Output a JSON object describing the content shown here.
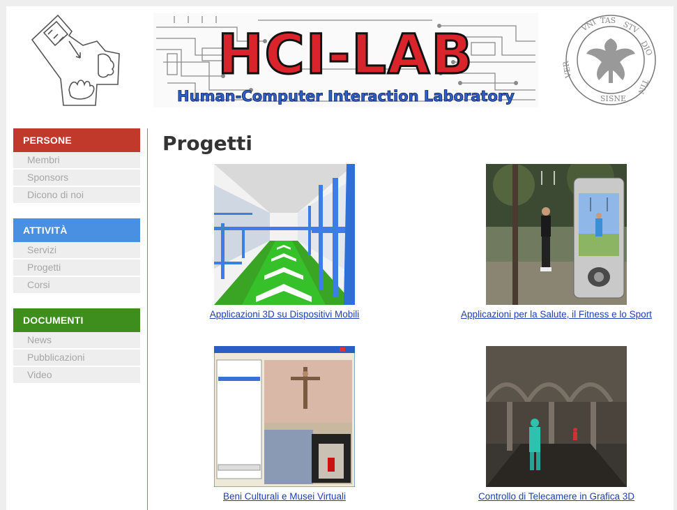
{
  "header": {
    "banner_title": "HCI-LAB",
    "banner_subtitle": "Human-Computer Interaction Laboratory"
  },
  "sidebar": {
    "sections": [
      {
        "title": "PERSONE",
        "color": "#c0392b",
        "items": [
          "Membri",
          "Sponsors",
          "Dicono di noi"
        ]
      },
      {
        "title": "ATTIVITÀ",
        "color": "#4a90e2",
        "items": [
          "Servizi",
          "Progetti",
          "Corsi"
        ]
      },
      {
        "title": "DOCUMENTI",
        "color": "#3e8e1d",
        "items": [
          "News",
          "Pubblicazioni",
          "Video"
        ]
      }
    ]
  },
  "main": {
    "title": "Progetti",
    "projects": [
      {
        "label": "Applicazioni 3D su Dispositivi Mobili"
      },
      {
        "label": "Applicazioni per la Salute, il Fitness e lo Sport"
      },
      {
        "label": "Beni Culturali e Musei Virtuali"
      },
      {
        "label": "Controllo di Telecamere in Grafica 3D"
      }
    ]
  },
  "colors": {
    "link": "#1f3fb2",
    "divider": "#5b8bd6",
    "banner_red": "#d8242a",
    "banner_blue": "#2f62c8"
  }
}
